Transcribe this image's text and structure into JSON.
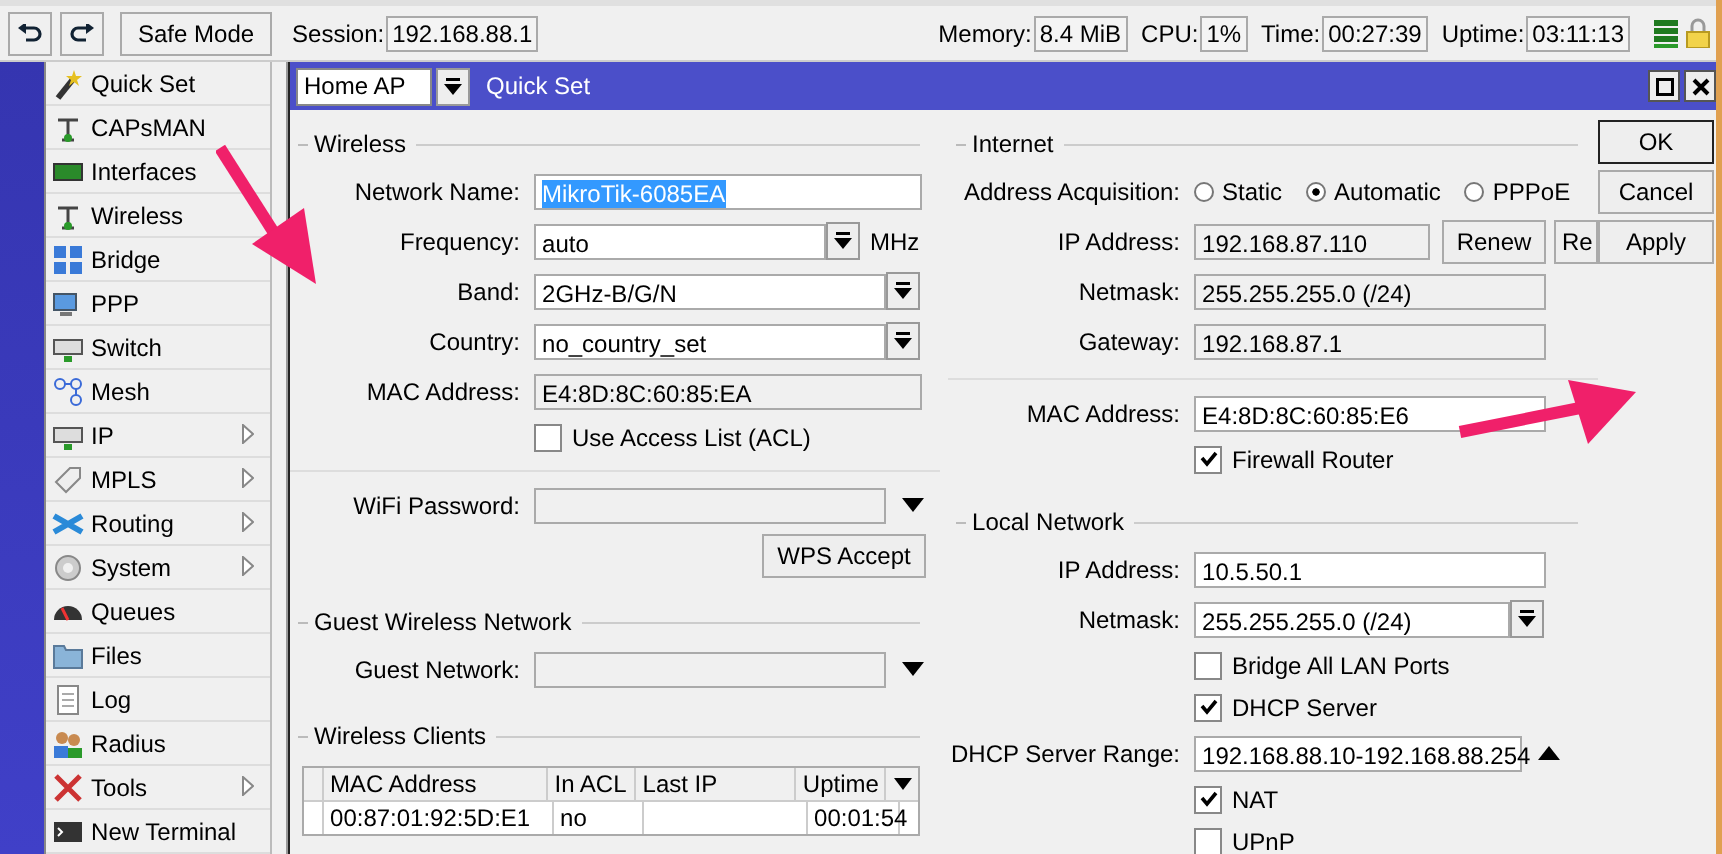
{
  "toolbar": {
    "safe_mode": "Safe Mode",
    "session_label": "Session:",
    "session": "192.168.88.1",
    "stats": [
      {
        "label": "Memory:",
        "value": "8.4 MiB"
      },
      {
        "label": "CPU:",
        "value": "1%"
      },
      {
        "label": "Time:",
        "value": "00:27:39"
      },
      {
        "label": "Uptime:",
        "value": "03:11:13"
      }
    ]
  },
  "sidebar": {
    "items": [
      {
        "label": "Quick Set",
        "submenu": false
      },
      {
        "label": "CAPsMAN",
        "submenu": false
      },
      {
        "label": "Interfaces",
        "submenu": false
      },
      {
        "label": "Wireless",
        "submenu": false
      },
      {
        "label": "Bridge",
        "submenu": false
      },
      {
        "label": "PPP",
        "submenu": false
      },
      {
        "label": "Switch",
        "submenu": false
      },
      {
        "label": "Mesh",
        "submenu": false
      },
      {
        "label": "IP",
        "submenu": true
      },
      {
        "label": "MPLS",
        "submenu": true
      },
      {
        "label": "Routing",
        "submenu": true
      },
      {
        "label": "System",
        "submenu": true
      },
      {
        "label": "Queues",
        "submenu": false
      },
      {
        "label": "Files",
        "submenu": false
      },
      {
        "label": "Log",
        "submenu": false
      },
      {
        "label": "Radius",
        "submenu": false
      },
      {
        "label": "Tools",
        "submenu": true
      },
      {
        "label": "New Terminal",
        "submenu": false
      }
    ]
  },
  "window": {
    "preset": "Home AP",
    "title": "Quick Set"
  },
  "left_sections": [
    {
      "title": "Wireless",
      "rows": [
        {
          "kind": "text",
          "label": "Network Name:",
          "value": "MikroTik-6085EA",
          "text_selected": true
        },
        {
          "kind": "select",
          "label": "Frequency:",
          "value": "auto",
          "unit": "MHz"
        },
        {
          "kind": "select",
          "label": "Band:",
          "value": "2GHz-B/G/N"
        },
        {
          "kind": "select",
          "label": "Country:",
          "value": "no_country_set"
        },
        {
          "kind": "readonly",
          "label": "MAC Address:",
          "value": "E4:8D:8C:60:85:EA"
        },
        {
          "kind": "checkbox",
          "label": "Use Access List (ACL)",
          "checked": false
        },
        {
          "kind": "combo",
          "label": "WiFi Password:",
          "divider_above": true,
          "expanded": false
        },
        {
          "kind": "button",
          "label": "WPS Accept"
        }
      ]
    },
    {
      "title": "Guest Wireless Network",
      "rows": [
        {
          "kind": "combo",
          "label": "Guest Network:",
          "expanded": false
        }
      ]
    },
    {
      "title": "Wireless Clients",
      "table": {
        "columns": [
          "MAC Address",
          "In ACL",
          "Last IP",
          "Uptime"
        ],
        "rows": [
          [
            "00:87:01:92:5D:E1",
            "no",
            "",
            "00:01:54"
          ]
        ]
      }
    }
  ],
  "right_sections": [
    {
      "title": "Internet",
      "rows": [
        {
          "kind": "radio",
          "label": "Address Acquisition:",
          "options": [
            {
              "label": "Static",
              "selected": false
            },
            {
              "label": "Automatic",
              "selected": true
            },
            {
              "label": "PPPoE",
              "selected": false
            }
          ]
        },
        {
          "kind": "readonly",
          "label": "IP Address:",
          "value": "192.168.87.110",
          "buttons": [
            "Renew",
            "Re"
          ]
        },
        {
          "kind": "readonly",
          "label": "Netmask:",
          "value": "255.255.255.0 (/24)"
        },
        {
          "kind": "readonly",
          "label": "Gateway:",
          "value": "192.168.87.1"
        },
        {
          "kind": "text",
          "label": "MAC Address:",
          "value": "E4:8D:8C:60:85:E6",
          "divider_above": true
        },
        {
          "kind": "checkbox",
          "label": "Firewall Router",
          "checked": true
        }
      ]
    },
    {
      "title": "Local Network",
      "rows": [
        {
          "kind": "text",
          "label": "IP Address:",
          "value": "10.5.50.1"
        },
        {
          "kind": "select",
          "label": "Netmask:",
          "value": "255.255.255.0 (/24)"
        },
        {
          "kind": "checkbox",
          "label": "Bridge All LAN Ports",
          "checked": false
        },
        {
          "kind": "checkbox",
          "label": "DHCP Server",
          "checked": true
        },
        {
          "kind": "combo",
          "label": "DHCP Server Range:",
          "value": "192.168.88.10-192.168.88.254",
          "expanded": true
        },
        {
          "kind": "checkbox",
          "label": "NAT",
          "checked": true
        },
        {
          "kind": "checkbox",
          "label": "UPnP",
          "checked": false
        }
      ]
    }
  ],
  "buttons": [
    "OK",
    "Cancel",
    "Apply"
  ]
}
